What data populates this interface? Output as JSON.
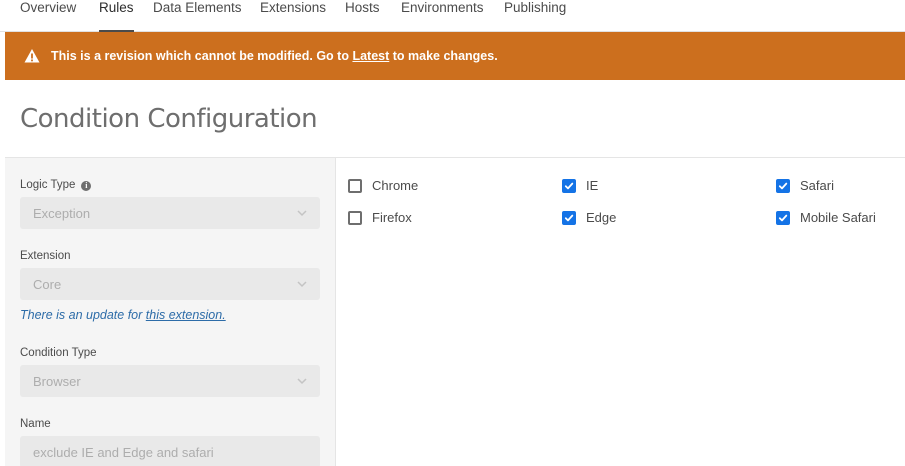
{
  "nav": {
    "tabs": [
      {
        "label": "Overview",
        "active": false
      },
      {
        "label": "Rules",
        "active": true
      },
      {
        "label": "Data Elements",
        "active": false
      },
      {
        "label": "Extensions",
        "active": false
      },
      {
        "label": "Hosts",
        "active": false
      },
      {
        "label": "Environments",
        "active": false
      },
      {
        "label": "Publishing",
        "active": false
      }
    ]
  },
  "banner": {
    "icon": "warning-icon",
    "prefix": "This is a revision which cannot be modified. Go to",
    "link": "Latest",
    "suffix": "to make changes.",
    "color": "#cc6f1e"
  },
  "page": {
    "title": "Condition Configuration"
  },
  "form": {
    "logic_type": {
      "label": "Logic Type",
      "value": "Exception"
    },
    "extension": {
      "label": "Extension",
      "value": "Core"
    },
    "update_note": {
      "prefix": "There is an update for",
      "link": "this extension."
    },
    "condition_type": {
      "label": "Condition Type",
      "value": "Browser"
    },
    "name": {
      "label": "Name",
      "value": "exclude IE and Edge and safari"
    }
  },
  "browsers": {
    "chrome": {
      "label": "Chrome",
      "checked": false
    },
    "firefox": {
      "label": "Firefox",
      "checked": false
    },
    "ie": {
      "label": "IE",
      "checked": true
    },
    "edge": {
      "label": "Edge",
      "checked": true
    },
    "safari": {
      "label": "Safari",
      "checked": true
    },
    "mobile_safari": {
      "label": "Mobile Safari",
      "checked": true
    }
  },
  "colors": {
    "accent": "#1473e6",
    "link": "#2d6ca8"
  }
}
